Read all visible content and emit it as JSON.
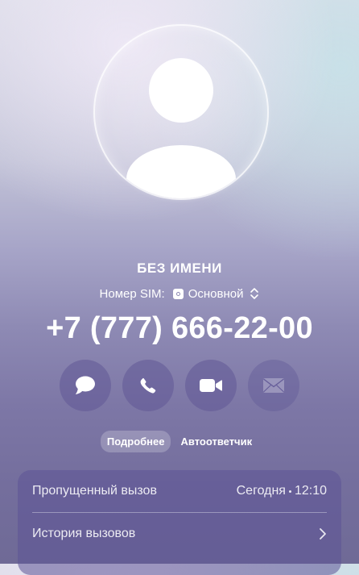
{
  "contact": {
    "name": "БЕЗ ИМЕНИ",
    "phone": "+7 (777) 666-22-00"
  },
  "sim": {
    "label": "Номер SIM:",
    "value": "Основной",
    "icon": "sim-card-icon"
  },
  "actions": [
    {
      "name": "message",
      "icon": "speech-bubble-icon"
    },
    {
      "name": "call",
      "icon": "phone-icon"
    },
    {
      "name": "video",
      "icon": "video-camera-icon"
    },
    {
      "name": "mail",
      "icon": "envelope-icon"
    }
  ],
  "tabs": [
    {
      "label": "Подробнее",
      "active": true
    },
    {
      "label": "Автоответчик",
      "active": false
    }
  ],
  "details": {
    "missed_call_label": "Пропущенный вызов",
    "missed_call_day": "Сегодня",
    "missed_call_time": "12:10",
    "history_label": "История вызовов"
  },
  "colors": {
    "button_bg": "#605896",
    "card_bg": "#5c5496",
    "text": "#ffffff"
  }
}
